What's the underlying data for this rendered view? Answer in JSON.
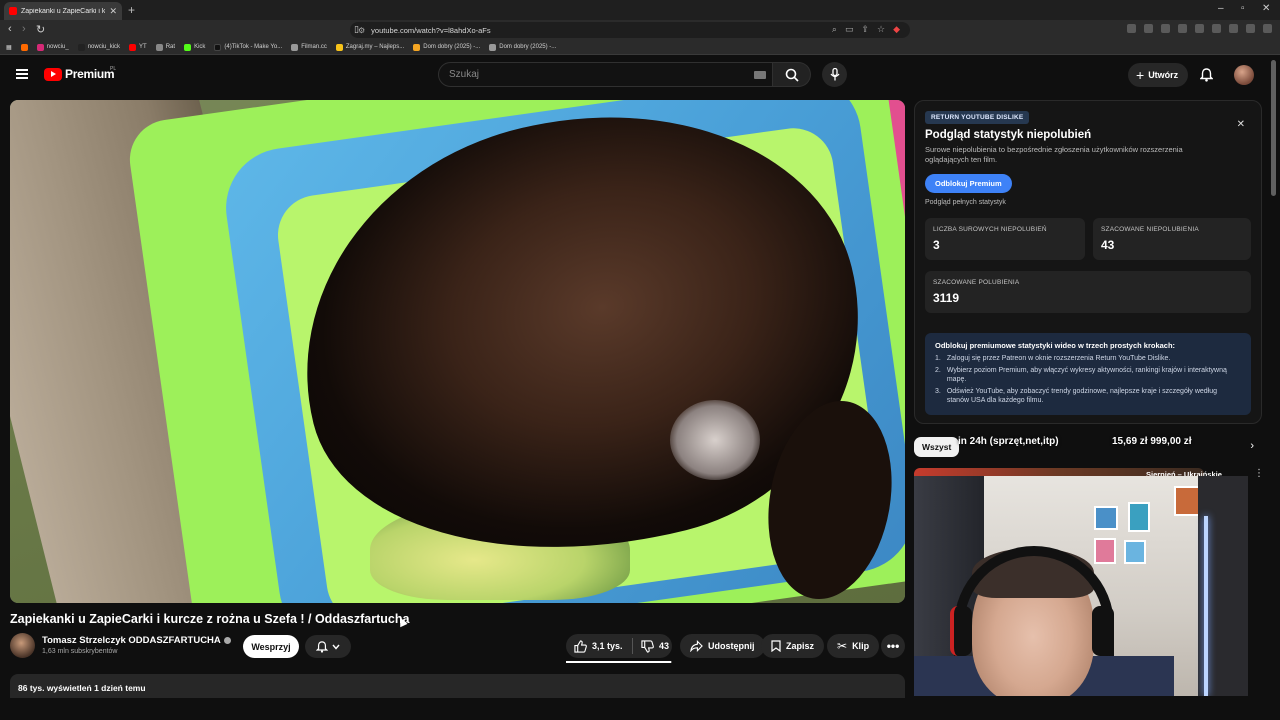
{
  "browser": {
    "tab_title": "Zapiekanki u ZapieCarki i ku...",
    "new_tab_icon": "+",
    "url": "youtube.com/watch?v=l8ahdXo-aFs",
    "bookmarks": [
      {
        "label": "nowciu_"
      },
      {
        "label": "nowciu_kick"
      },
      {
        "label": "YT"
      },
      {
        "label": "Rat"
      },
      {
        "label": "Kick"
      },
      {
        "label": "(4)TikTok - Make Yo..."
      },
      {
        "label": "Filman.cc"
      },
      {
        "label": "Zagraj.my – Najleps..."
      },
      {
        "label": "Dom dobry (2025) -..."
      },
      {
        "label": "Dom dobry (2025) -..."
      }
    ]
  },
  "masthead": {
    "logo_text": "Premium",
    "country": "PL",
    "search_placeholder": "Szukaj",
    "create_label": "Utwórz"
  },
  "video": {
    "title": "Zapiekanki u ZapieCarki i kurcze z rożna u Szefa ! / Oddaszfartucha",
    "channel_name": "Tomasz Strzelczyk ODDASZFARTUCHA",
    "subscribers": "1,63 mln subskrybentów",
    "support_label": "Wesprzyj",
    "likes": "3,1 tys.",
    "dislikes": "43",
    "like_ratio": 0.986,
    "share_label": "Udostępnij",
    "save_label": "Zapisz",
    "clip_label": "Klip",
    "views_date": "86 tys. wyświetleń  1 dzień temu"
  },
  "ryd": {
    "badge": "RETURN YOUTUBE DISLIKE",
    "title": "Podgląd statystyk niepolubień",
    "description": "Surowe niepolubienia to bezpośrednie zgłoszenia użytkowników rozszerzenia oglądających ten film.",
    "unlock_label": "Odblokuj Premium",
    "full_stats": "Podgląd pełnych statystyk",
    "stats": [
      {
        "label": "LICZBA SUROWYCH NIEPOLUBIEŃ",
        "value": "3"
      },
      {
        "label": "SZACOWANE NIEPOLUBIENIA",
        "value": "43"
      },
      {
        "label": "SZACOWANE POLUBIENIA",
        "value": "3119"
      }
    ],
    "steps_title": "Odblokuj premiumowe statystyki wideo w trzech prostych krokach:",
    "steps": [
      {
        "n": "1.",
        "text": "Zaloguj się przez Patreon w oknie rozszerzenia Return YouTube Dislike."
      },
      {
        "n": "2.",
        "text": "Wybierz poziom Premium, aby włączyć wykresy aktywności, rankingi krajów i interaktywną mapę."
      },
      {
        "n": "3.",
        "text": "Odśwież YouTube, aby zobaczyć trendy godzinowe, najlepsze kraje i szczegóły według stanów USA dla każdego filmu."
      }
    ]
  },
  "sidebar": {
    "chip_all": "Wszyst",
    "overlay_text": "in 24h (sprzęt,net,itp)",
    "overlay_price": "15,69 zł    999,00 zł",
    "rec_title": "Sierpień – Ukraińskie"
  },
  "colors": {
    "brand_red": "#ff0000",
    "accent_blue": "#3e82f7",
    "bg": "#0f0f0f"
  }
}
